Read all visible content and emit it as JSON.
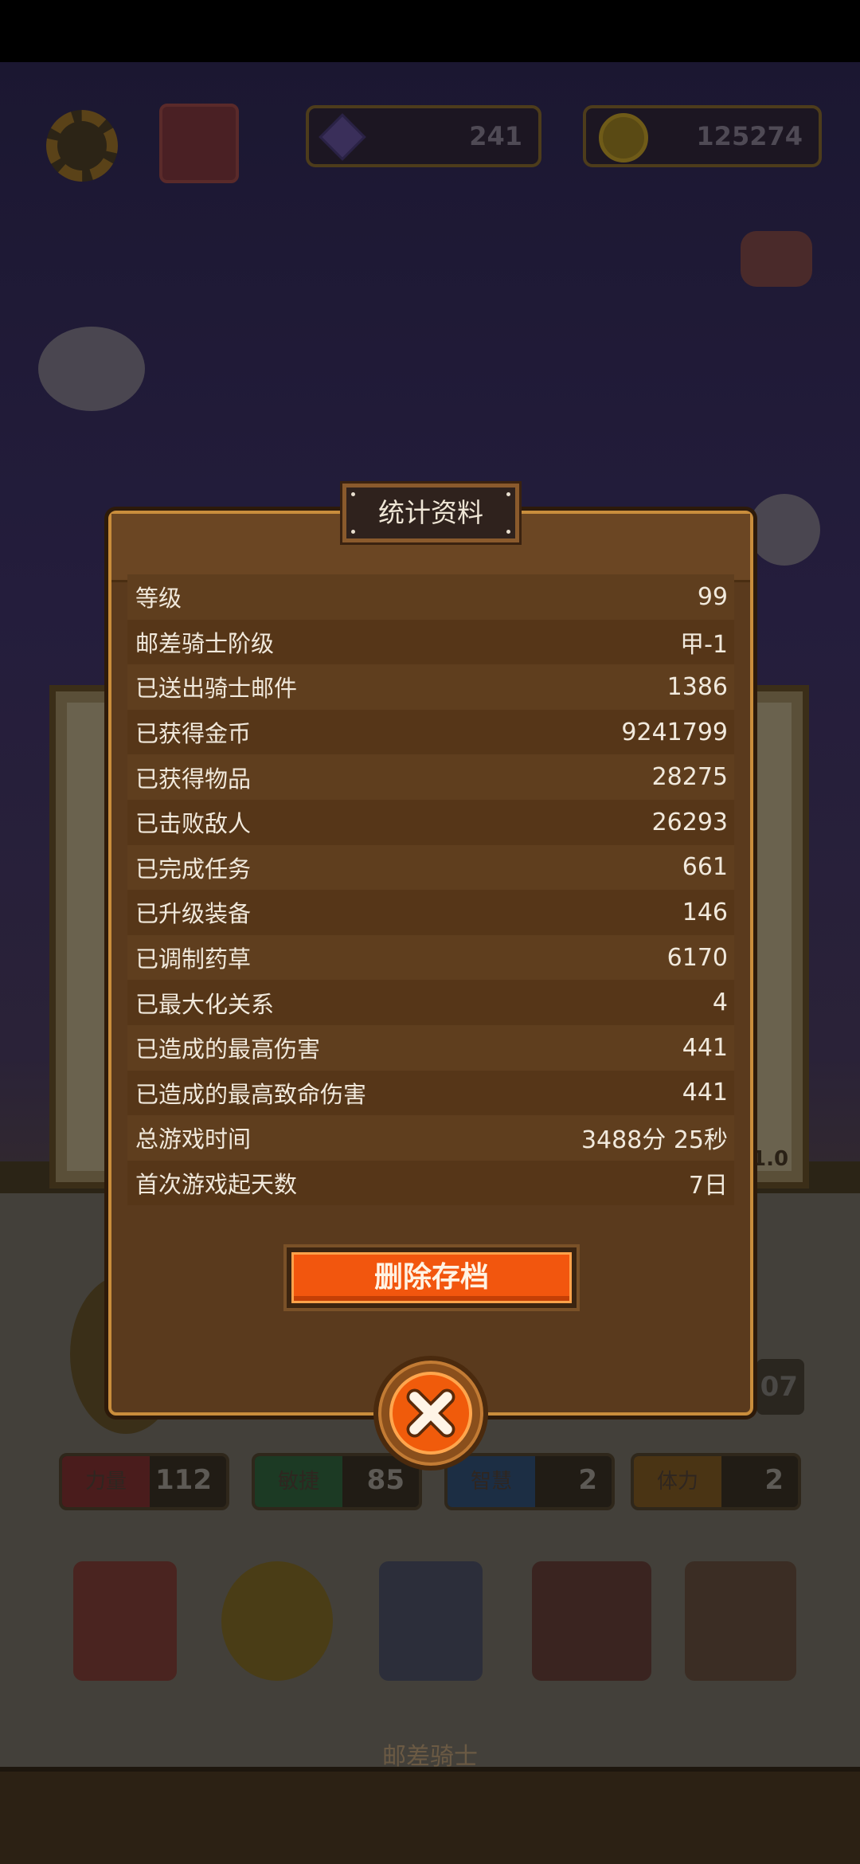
{
  "hud": {
    "gems": "241",
    "coins": "125274"
  },
  "background": {
    "version_text": "1.0",
    "tile_right_value": "07",
    "footer_title": "邮差骑士",
    "stats": [
      {
        "label": "力量",
        "value": "112",
        "color": "#4a1c1c"
      },
      {
        "label": "敏捷",
        "value": "85",
        "color": "#1c3a24"
      },
      {
        "label": "智慧",
        "value": "2",
        "color": "#1c2e44"
      },
      {
        "label": "体力",
        "value": "2",
        "color": "#4a3414"
      }
    ]
  },
  "dialog": {
    "title": "统计资料",
    "rows": [
      {
        "label": "等级",
        "value": "99"
      },
      {
        "label": "邮差骑士阶级",
        "value": "甲-1"
      },
      {
        "label": "已送出骑士邮件",
        "value": "1386"
      },
      {
        "label": "已获得金币",
        "value": "9241799"
      },
      {
        "label": "已获得物品",
        "value": "28275"
      },
      {
        "label": "已击败敌人",
        "value": "26293"
      },
      {
        "label": "已完成任务",
        "value": "661"
      },
      {
        "label": "已升级装备",
        "value": "146"
      },
      {
        "label": "已调制药草",
        "value": "6170"
      },
      {
        "label": "已最大化关系",
        "value": "4"
      },
      {
        "label": "已造成的最高伤害",
        "value": "441"
      },
      {
        "label": "已造成的最高致命伤害",
        "value": "441"
      },
      {
        "label": "总游戏时间",
        "value": "3488分 25秒"
      },
      {
        "label": "首次游戏起天数",
        "value": "7日"
      }
    ],
    "delete_label": "删除存档"
  },
  "colors": {
    "accent_orange": "#f2560e",
    "panel_brown": "#5a3a1d",
    "border_gold": "#c98d3c"
  },
  "icons": [
    "gear-icon",
    "gift-icon",
    "gem-icon",
    "coin-icon",
    "close-icon"
  ]
}
